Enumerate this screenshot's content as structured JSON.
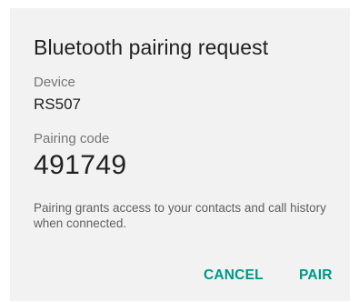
{
  "dialog": {
    "title": "Bluetooth pairing request",
    "device_label": "Device",
    "device_name": "RS507",
    "pairing_code_label": "Pairing code",
    "pairing_code": "491749",
    "message": "Pairing grants access to your contacts and call history when connected.",
    "cancel_label": "CANCEL",
    "pair_label": "PAIR"
  },
  "colors": {
    "dialog_background": "#f2f2f2",
    "accent": "#009688",
    "primary_text": "#212121",
    "secondary_text": "#757575"
  }
}
